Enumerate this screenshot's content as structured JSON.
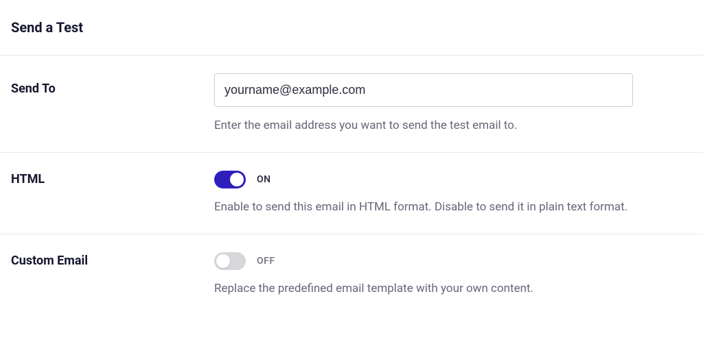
{
  "section_title": "Send a Test",
  "fields": {
    "send_to": {
      "label": "Send To",
      "value": "yourname@example.com",
      "help": "Enter the email address you want to send the test email to."
    },
    "html": {
      "label": "HTML",
      "state": "ON",
      "on": true,
      "help": "Enable to send this email in HTML format. Disable to send it in plain text format."
    },
    "custom_email": {
      "label": "Custom Email",
      "state": "OFF",
      "on": false,
      "help": "Replace the predefined email template with your own content."
    }
  }
}
